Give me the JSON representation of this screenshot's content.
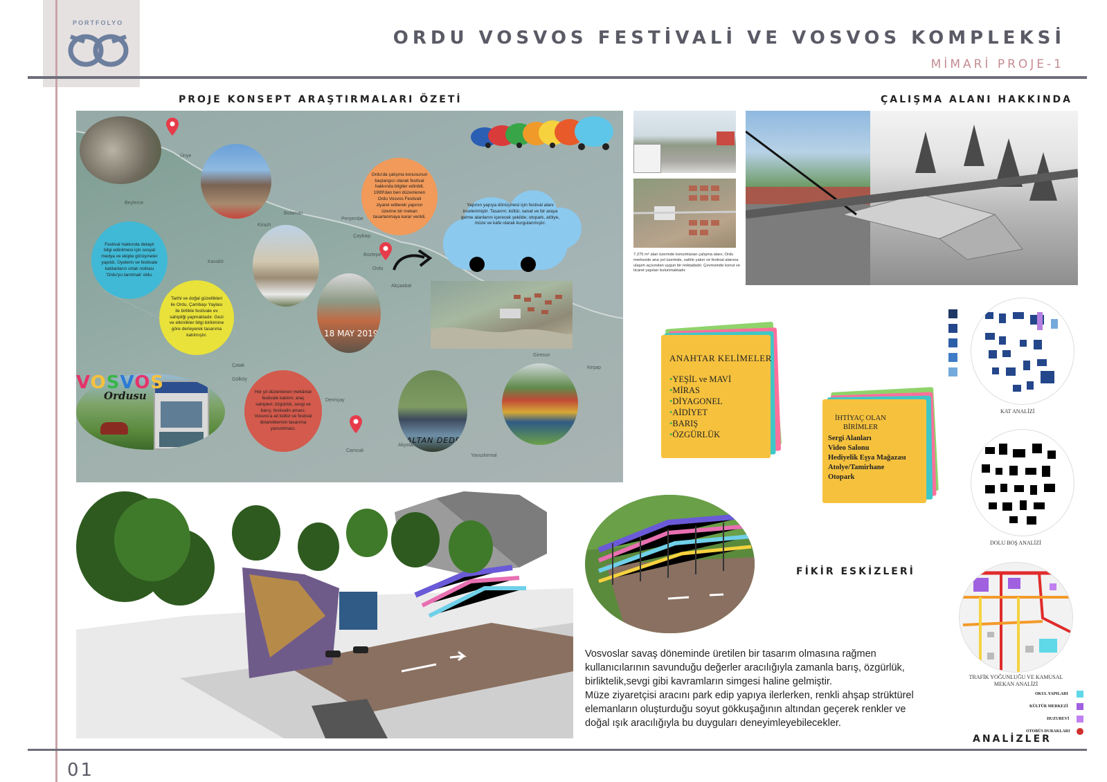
{
  "header": {
    "logo_text": "PORTFOLYO",
    "title": "ORDU VOSVOS FESTİVALİ VE VOSVOS KOMPLEKSİ",
    "subtitle": "MİMARİ PROJE-1"
  },
  "sections": {
    "concept": "PROJE KONSEPT  ARAŞTIRMALARI ÖZETİ",
    "study_area": "ÇALIŞMA ALANI HAKKINDA",
    "sketches": "FİKİR ESKİZLERİ",
    "analyses": "ANALİZLER"
  },
  "map": {
    "places": [
      "Ünye",
      "Beylerce",
      "Bolaman",
      "Kirazlı",
      "Perşembe",
      "Çaybaşı",
      "Kavaklı",
      "Boztepe",
      "Ordu",
      "Akçaabat",
      "Çatak",
      "Giresun",
      "Keşap",
      "Gölköy",
      "Derinçay",
      "Camcalı",
      "Akyolan",
      "Yavuzkemal"
    ],
    "date_label": "18 MAY 2019",
    "person_label": "ALTAN DEDE",
    "logo_word": "VOSVOS",
    "logo_sub": "Ordusu",
    "bubble_orange": "Ordu'da çalışma konusunun başlangıcı olarak festival hakkında bilgiler edinildi. 1999'dan beri düzenlenen Ordu Vosvos Festivali ziyaret edilerek yapının üzerine bir mekan tasarlanmaya karar verildi.",
    "bubble_blue": "Festival hakkında detaylı bilgi edinilmesi için sosyal medya ve ekiple görüşmeler yapıldı. Üyelerin ve festivale katılanların ortak noktası 'Ordu'yu tanıtmak' oldu.",
    "bubble_yellow": "Tarihi ve doğal güzellikleri ile Ordu, Çambaşı Yaylası ile birlikte festivale ev sahipliği yapmaktadır. Gezi ve etkinlikler bilgi birikimine göre derleyerek tasarıma katılmıştır.",
    "bubble_red": "Her yıl düzenlenen mekânlar festivale katılım; araç sahipleri; özgürlük, sevgi ve barış; festivalin amacı; Vosvos'a ait kültür ve festival dinamiklerinin tasarıma yansıtılması.",
    "cloud_text": "Yapının yapıya dönüşmesi için festival alanı incelenmiştir. Tasarım; kültür, sanat ve bir araya gelme alanlarını içerecek şekilde; otopark, atölye, müze ve kafe olarak kurgulanmıştır."
  },
  "study": {
    "caption": "7.275 m² alan üzerinde konumlanan çalışma alanı; Ordu merkezde ana yol üzerinde, sahile yakın ve festival alanına ulaşım açısından uygun bir noktadadır. Çevresinde konut ve ticaret yapıları bulunmaktadır."
  },
  "keywords": {
    "title": "ANAHTAR KELİMELER",
    "items": [
      "YEŞİL ve MAVİ",
      "MİRAS",
      "DİYAGONEL",
      "AİDİYET",
      "BARIŞ",
      "ÖZGÜRLÜK"
    ]
  },
  "needs": {
    "title_line1": "İHTİYAÇ OLAN",
    "title_line2": "BİRİMLER",
    "items": [
      "Sergi Alanları",
      "Video Salonu",
      "Hediyelik Eşya Mağazası",
      "Atolye/Tamirhane",
      "Otopark"
    ]
  },
  "analysis": {
    "labels": [
      "KAT ANALİZİ",
      "DOLU BOŞ ANALİZİ",
      "TRAFİK YOĞUNLUĞU VE KAMUSAL MEKAN ANALİZİ"
    ],
    "legend": [
      {
        "label": "OKUL YAPILARI",
        "color": "#5fd8e8"
      },
      {
        "label": "KÜLTÜR MERKEZİ",
        "color": "#a060e0"
      },
      {
        "label": "HUZUREVİ",
        "color": "#c080f0"
      },
      {
        "label": "OTOBÜS DURAKLARI",
        "color": "#d03030"
      }
    ]
  },
  "description": {
    "p1": "  Vosvoslar savaş döneminde üretilen bir tasarım olmasına rağmen kullanıcılarının savunduğu değerler aracılığıyla zamanla barış, özgürlük, birliktelik,sevgi gibi kavramların simgesi haline gelmiştir.",
    "p2": "  Müze ziyaretçisi aracını park edip yapıya ilerlerken, renkli ahşap strüktürel elemanların oluşturduğu soyut gökkuşağının altından geçerek renkler ve doğal ışık aracılığıyla bu duyguları deneyimleyebilecekler."
  },
  "page_number": "01",
  "colors": {
    "frame_line": "#6d6e7a",
    "accent_pink": "#c48b92",
    "note_yellow": "#f6c23e",
    "note_green": "#8fd36a",
    "note_pink": "#ff6f9c",
    "note_teal": "#3fc7c7"
  }
}
